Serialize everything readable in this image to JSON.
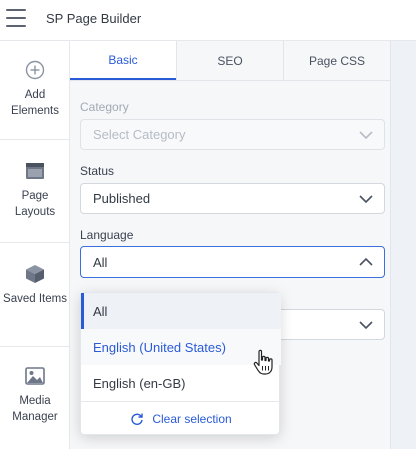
{
  "header": {
    "title": "SP Page Builder"
  },
  "sidebar": {
    "items": [
      {
        "label": "Add Elements",
        "icon": "plus-circle-icon"
      },
      {
        "label": "Page Layouts",
        "icon": "layout-icon"
      },
      {
        "label": "Saved Items",
        "icon": "box-icon"
      },
      {
        "label": "Media Manager",
        "icon": "image-icon"
      }
    ]
  },
  "tabs": [
    {
      "label": "Basic",
      "active": true
    },
    {
      "label": "SEO",
      "active": false
    },
    {
      "label": "Page CSS",
      "active": false
    }
  ],
  "form": {
    "category": {
      "label": "Category",
      "placeholder": "Select Category",
      "disabled": true
    },
    "status": {
      "label": "Status",
      "value": "Published"
    },
    "language": {
      "label": "Language",
      "value": "All",
      "open": true
    }
  },
  "language_dropdown": {
    "options": [
      "All",
      "English (United States)",
      "English (en-GB)"
    ],
    "selected": "All",
    "hovered": "English (United States)",
    "clear_label": "Clear selection"
  },
  "colors": {
    "accent": "#2a5bd7",
    "border": "#d3d7de",
    "panel_bg": "#f6f7f9"
  }
}
